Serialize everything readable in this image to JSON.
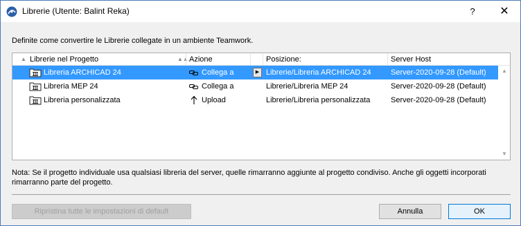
{
  "window": {
    "title": "Librerie (Utente: Balint Reka)",
    "help_label": "?",
    "close_label": "✕"
  },
  "instruction": "Definite come convertire le Librerie collegate in un ambiente Teamwork.",
  "table": {
    "columns": [
      "Librerie nel Progetto",
      "Azione",
      "Posizione:",
      "Server Host"
    ],
    "rows": [
      {
        "name": "Libreria ARCHICAD 24",
        "action": "Collega a",
        "action_icon": "link-icon",
        "position": "Librerie/Libreria ARCHICAD 24",
        "server": "Server-2020-09-28 (Default)",
        "selected": true
      },
      {
        "name": "Libreria MEP 24",
        "action": "Collega a",
        "action_icon": "link-icon",
        "position": "Librerie/Libreria MEP 24",
        "server": "Server-2020-09-28 (Default)",
        "selected": false
      },
      {
        "name": "Libreria personalizzata",
        "action": "Upload",
        "action_icon": "upload-arrow-icon",
        "position": "Librerie/Libreria personalizzata",
        "server": "Server-2020-09-28 (Default)",
        "selected": false
      }
    ]
  },
  "note": "Nota: Se il progetto individuale usa qualsiasi libreria del server, quelle rimarranno aggiunte al progetto condiviso. Anche gli oggetti incorporati rimarranno parte del progetto.",
  "buttons": {
    "reset": "Ripristina tutte le impostazioni di default",
    "cancel": "Annulla",
    "ok": "OK"
  },
  "colors": {
    "selection": "#3399ff",
    "default_button_border": "#0078d7"
  }
}
